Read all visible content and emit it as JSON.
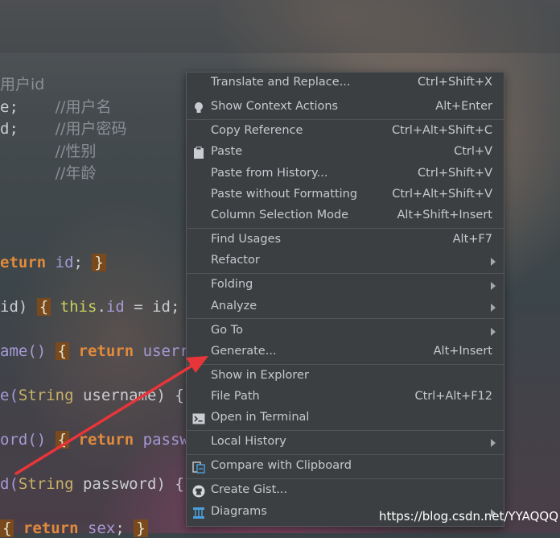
{
  "code_lines": [
    {
      "segments": [
        {
          "t": "用户id",
          "c": "cm"
        }
      ]
    },
    {
      "segments": [
        {
          "t": "e;    ",
          "c": "plain"
        },
        {
          "t": "//用户名",
          "c": "cm"
        }
      ]
    },
    {
      "segments": [
        {
          "t": "d;    ",
          "c": "plain"
        },
        {
          "t": "//用户密码",
          "c": "cm"
        }
      ]
    },
    {
      "segments": [
        {
          "t": "      ",
          "c": "plain"
        },
        {
          "t": "//性别",
          "c": "cm"
        }
      ]
    },
    {
      "segments": [
        {
          "t": "      ",
          "c": "plain"
        },
        {
          "t": "//年龄",
          "c": "cm"
        }
      ]
    },
    {
      "segments": [
        {
          "t": "eturn ",
          "c": "kw"
        },
        {
          "t": "id",
          "c": "fld"
        },
        {
          "t": "; ",
          "c": "plain"
        },
        {
          "t": "}",
          "c": "br"
        }
      ]
    },
    {
      "segments": [
        {
          "t": "id) ",
          "c": "plain"
        },
        {
          "t": "{",
          "c": "br"
        },
        {
          "t": " ",
          "c": "plain"
        },
        {
          "t": "this",
          "c": "th"
        },
        {
          "t": ".",
          "c": "plain"
        },
        {
          "t": "id",
          "c": "fld"
        },
        {
          "t": " = id;",
          "c": "plain"
        }
      ]
    },
    {
      "segments": [
        {
          "t": "ame() ",
          "c": "fld"
        },
        {
          "t": "{",
          "c": "br"
        },
        {
          "t": " ",
          "c": "plain"
        },
        {
          "t": "return ",
          "c": "kw"
        },
        {
          "t": "userr",
          "c": "fld"
        }
      ]
    },
    {
      "segments": [
        {
          "t": "e(",
          "c": "fld"
        },
        {
          "t": "String",
          "c": "ty"
        },
        {
          "t": " username) {",
          "c": "plain"
        }
      ]
    },
    {
      "segments": [
        {
          "t": "ord() ",
          "c": "fld"
        },
        {
          "t": "{",
          "c": "br"
        },
        {
          "t": " ",
          "c": "plain"
        },
        {
          "t": "return ",
          "c": "kw"
        },
        {
          "t": "passw",
          "c": "fld"
        }
      ]
    },
    {
      "segments": [
        {
          "t": "d(",
          "c": "fld"
        },
        {
          "t": "String",
          "c": "ty"
        },
        {
          "t": " password) {",
          "c": "plain"
        }
      ]
    },
    {
      "segments": [
        {
          "t": "{",
          "c": "br"
        },
        {
          "t": " ",
          "c": "plain"
        },
        {
          "t": "return ",
          "c": "kw"
        },
        {
          "t": "sex",
          "c": "fld"
        },
        {
          "t": "; ",
          "c": "plain"
        },
        {
          "t": "}",
          "c": "br"
        }
      ]
    }
  ],
  "menu": {
    "items": [
      {
        "label": "Translate and Replace...",
        "shortcut": "Ctrl+Shift+X",
        "icon": "",
        "submenu": false
      },
      {
        "label": "Show Context Actions",
        "shortcut": "Alt+Enter",
        "icon": "lightbulb-icon",
        "submenu": false
      },
      {
        "label": "Copy Reference",
        "shortcut": "Ctrl+Alt+Shift+C",
        "icon": "",
        "submenu": false
      },
      {
        "label": "Paste",
        "shortcut": "Ctrl+V",
        "icon": "clipboard-icon",
        "submenu": false
      },
      {
        "label": "Paste from History...",
        "shortcut": "Ctrl+Shift+V",
        "icon": "",
        "submenu": false
      },
      {
        "label": "Paste without Formatting",
        "shortcut": "Ctrl+Alt+Shift+V",
        "icon": "",
        "submenu": false
      },
      {
        "label": "Column Selection Mode",
        "shortcut": "Alt+Shift+Insert",
        "icon": "",
        "submenu": false
      },
      {
        "label": "Find Usages",
        "shortcut": "Alt+F7",
        "icon": "",
        "submenu": false
      },
      {
        "label": "Refactor",
        "shortcut": "",
        "icon": "",
        "submenu": true
      },
      {
        "label": "Folding",
        "shortcut": "",
        "icon": "",
        "submenu": true
      },
      {
        "label": "Analyze",
        "shortcut": "",
        "icon": "",
        "submenu": true
      },
      {
        "label": "Go To",
        "shortcut": "",
        "icon": "",
        "submenu": true
      },
      {
        "label": "Generate...",
        "shortcut": "Alt+Insert",
        "icon": "",
        "submenu": false
      },
      {
        "label": "Show in Explorer",
        "shortcut": "",
        "icon": "",
        "submenu": false
      },
      {
        "label": "File Path",
        "shortcut": "Ctrl+Alt+F12",
        "icon": "",
        "submenu": false
      },
      {
        "label": "Open in Terminal",
        "shortcut": "",
        "icon": "terminal-icon",
        "submenu": false
      },
      {
        "label": "Local History",
        "shortcut": "",
        "icon": "",
        "submenu": true
      },
      {
        "label": "Compare with Clipboard",
        "shortcut": "",
        "icon": "compare-clipboard-icon",
        "submenu": false
      },
      {
        "label": "Create Gist...",
        "shortcut": "",
        "icon": "github-icon",
        "submenu": false
      },
      {
        "label": "Diagrams",
        "shortcut": "",
        "icon": "diagram-icon",
        "submenu": true
      }
    ]
  },
  "watermark": "https://blog.csdn.net/YYAQQQ",
  "colors": {
    "menu_bg": "#3c3f41",
    "menu_text": "#c5c9cd",
    "arrow": "#e8353a"
  }
}
